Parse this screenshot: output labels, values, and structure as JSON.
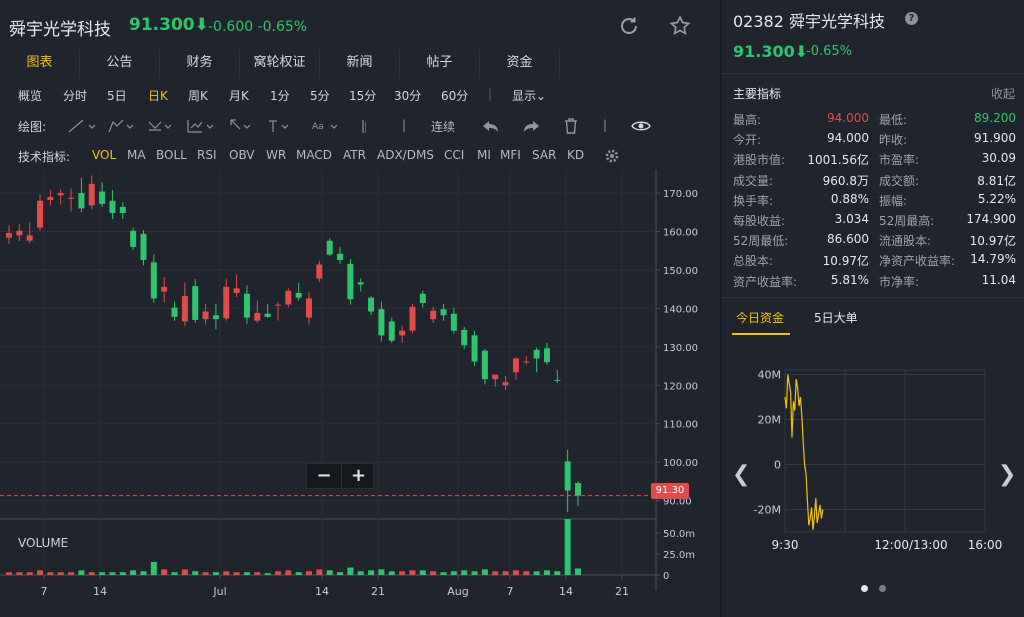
{
  "header": {
    "stock_name": "舜宇光学科技",
    "price": "91.300⬇",
    "change": "-0.600  -0.65%"
  },
  "tabs": [
    "图表",
    "公告",
    "财务",
    "窝轮权证",
    "新闻",
    "帖子",
    "资金"
  ],
  "periods": [
    "概览",
    "分时",
    "5日",
    "日K",
    "周K",
    "月K",
    "1分",
    "5分",
    "15分",
    "30分",
    "60分",
    "|",
    "显示⌄"
  ],
  "drawbar": {
    "label": "绘图:",
    "continuous": "连续"
  },
  "indicators": {
    "label": "技术指标:",
    "items": [
      "VOL",
      "MA",
      "BOLL",
      "RSI",
      "OBV",
      "WR",
      "MACD",
      "ATR",
      "ADX/DMS",
      "CCI",
      "MI",
      "MFI",
      "SAR",
      "KD"
    ]
  },
  "volume_label": "VOLUME",
  "zoom": {
    "minus": "−",
    "plus": "+"
  },
  "current_price_tag": "91.30",
  "chart_data": {
    "type": "candlestick",
    "y_ticks": [
      "170.00",
      "160.00",
      "150.00",
      "140.00",
      "130.00",
      "120.00",
      "110.00",
      "100.00",
      "90.00"
    ],
    "y_range": [
      86,
      176
    ],
    "volume_ticks": [
      "50.0m",
      "25.0m",
      "0"
    ],
    "x_ticks": [
      "7",
      "14",
      "Jul",
      "14",
      "21",
      "Aug",
      "7",
      "14",
      "21"
    ],
    "current_price": 91.3,
    "candles": [
      [
        158.4,
        161.6,
        156.8,
        159.6
      ],
      [
        159.0,
        162.0,
        157.5,
        160.2
      ],
      [
        157.6,
        162.4,
        157.0,
        159.0
      ],
      [
        161.0,
        169.6,
        160.2,
        168.0
      ],
      [
        168.2,
        170.8,
        166.8,
        169.0
      ],
      [
        169.4,
        171.0,
        167.0,
        170.0
      ],
      [
        168.5,
        171.2,
        165.2,
        168.8
      ],
      [
        170.0,
        174.0,
        165.0,
        166.0
      ],
      [
        166.8,
        174.6,
        165.8,
        172.4
      ],
      [
        170.4,
        172.8,
        166.4,
        167.2
      ],
      [
        168.0,
        170.8,
        163.2,
        164.8
      ],
      [
        166.4,
        167.6,
        163.2,
        164.8
      ],
      [
        160.2,
        161.0,
        155.2,
        156.0
      ],
      [
        159.4,
        160.4,
        151.2,
        152.6
      ],
      [
        152.0,
        154.0,
        141.4,
        142.6
      ],
      [
        144.4,
        148.2,
        141.6,
        145.6
      ],
      [
        140.2,
        141.8,
        136.8,
        137.8
      ],
      [
        136.6,
        146.8,
        135.4,
        143.2
      ],
      [
        145.8,
        147.6,
        136.2,
        137.0
      ],
      [
        137.2,
        141.2,
        135.8,
        139.2
      ],
      [
        138.2,
        141.2,
        134.6,
        137.2
      ],
      [
        137.4,
        147.6,
        136.8,
        145.6
      ],
      [
        144.0,
        148.8,
        143.0,
        145.2
      ],
      [
        143.8,
        146.0,
        136.0,
        137.6
      ],
      [
        136.8,
        142.0,
        136.2,
        138.8
      ],
      [
        138.6,
        141.2,
        137.6,
        137.8
      ],
      [
        140.8,
        141.6,
        136.8,
        141.0
      ],
      [
        141.0,
        145.2,
        140.2,
        144.6
      ],
      [
        144.0,
        146.6,
        142.0,
        142.8
      ],
      [
        137.6,
        144.2,
        135.8,
        142.6
      ],
      [
        147.8,
        152.4,
        146.8,
        151.4
      ],
      [
        157.6,
        158.2,
        153.6,
        154.0
      ],
      [
        154.2,
        156.0,
        151.6,
        152.6
      ],
      [
        151.6,
        152.8,
        141.0,
        142.4
      ],
      [
        146.8,
        147.8,
        144.4,
        146.2
      ],
      [
        142.8,
        143.2,
        138.2,
        139.2
      ],
      [
        139.8,
        141.8,
        131.4,
        133.0
      ],
      [
        136.6,
        137.6,
        131.0,
        131.6
      ],
      [
        133.0,
        135.4,
        131.0,
        134.2
      ],
      [
        134.2,
        141.2,
        133.6,
        140.4
      ],
      [
        143.8,
        144.6,
        140.2,
        141.4
      ],
      [
        137.2,
        140.4,
        136.2,
        139.4
      ],
      [
        139.8,
        141.2,
        136.8,
        138.2
      ],
      [
        138.6,
        140.2,
        133.4,
        134.2
      ],
      [
        134.4,
        135.2,
        129.4,
        130.4
      ],
      [
        133.0,
        134.2,
        125.0,
        126.2
      ],
      [
        129.0,
        129.4,
        120.2,
        121.6
      ],
      [
        121.6,
        122.8,
        119.6,
        122.8
      ],
      [
        120.0,
        122.4,
        118.8,
        120.8
      ],
      [
        123.4,
        127.2,
        121.4,
        127.0
      ],
      [
        126.0,
        127.6,
        125.4,
        126.2
      ],
      [
        129.2,
        129.8,
        123.4,
        127.0
      ],
      [
        129.6,
        131.0,
        125.4,
        126.0
      ],
      [
        121.4,
        124.0,
        120.6,
        121.2
      ],
      [
        100.2,
        103.2,
        87.0,
        92.6
      ],
      [
        94.6,
        95.0,
        88.6,
        91.3
      ]
    ],
    "volumes": [
      3,
      3,
      3,
      5,
      3,
      3,
      3,
      5,
      3,
      3,
      3,
      3,
      5,
      4,
      14,
      6,
      3,
      6,
      4,
      3,
      3,
      4,
      3,
      3,
      3,
      2,
      4,
      5,
      3,
      4,
      6,
      5,
      3,
      8,
      4,
      5,
      6,
      4,
      4,
      5,
      5,
      4,
      3,
      4,
      5,
      4,
      6,
      4,
      4,
      5,
      4,
      4,
      5,
      4,
      60,
      7
    ]
  },
  "right": {
    "title": "02382 舜宇光学科技",
    "help": "?",
    "price": "91.300⬇",
    "pct": "-0.65%",
    "section": "主要指标",
    "collapse": "收起",
    "metrics": [
      {
        "k1": "最高:",
        "v1": "94.000",
        "c1": "red",
        "k2": "最低:",
        "v2": "89.200",
        "c2": "green"
      },
      {
        "k1": "今开:",
        "v1": "94.000",
        "c1": "",
        "k2": "昨收:",
        "v2": "91.900",
        "c2": ""
      },
      {
        "k1": "港股市值:",
        "v1": "1001.56亿",
        "c1": "",
        "k2": "市盈率:",
        "v2": "30.09",
        "c2": ""
      },
      {
        "k1": "成交量:",
        "v1": "960.8万",
        "c1": "",
        "k2": "成交额:",
        "v2": "8.81亿",
        "c2": ""
      },
      {
        "k1": "换手率:",
        "v1": "0.88%",
        "c1": "",
        "k2": "振幅:",
        "v2": "5.22%",
        "c2": ""
      },
      {
        "k1": "每股收益:",
        "v1": "3.034",
        "c1": "",
        "k2": "52周最高:",
        "v2": "174.900",
        "c2": ""
      },
      {
        "k1": "52周最低:",
        "v1": "86.600",
        "c1": "",
        "k2": "流通股本:",
        "v2": "10.97亿",
        "c2": ""
      },
      {
        "k1": "总股本:",
        "v1": "10.97亿",
        "c1": "",
        "k2": "净资产收益率:",
        "v2": "14.79%",
        "c2": ""
      },
      {
        "k1": "资产收益率:",
        "v1": "5.81%",
        "c1": "",
        "k2": "市净率:",
        "v2": "11.04",
        "c2": ""
      }
    ],
    "money_tabs": [
      "今日资金",
      "5日大单"
    ],
    "mini_chart": {
      "y_ticks": [
        "40M",
        "20M",
        "0",
        "-20M"
      ],
      "x_ticks": [
        "9:30",
        "12:00/13:00",
        "16:00"
      ],
      "y_range": [
        -30,
        42
      ],
      "values": [
        30,
        25,
        40,
        36,
        32,
        12,
        28,
        24,
        38,
        34,
        26,
        30,
        22,
        10,
        0,
        -4,
        -16,
        -27,
        -24,
        -19,
        -29,
        -23,
        -15,
        -26,
        -22,
        -18,
        -24,
        -20
      ]
    }
  },
  "colors": {
    "up": "#e34b4b",
    "down": "#2ec56e",
    "accent": "#f5c400"
  }
}
